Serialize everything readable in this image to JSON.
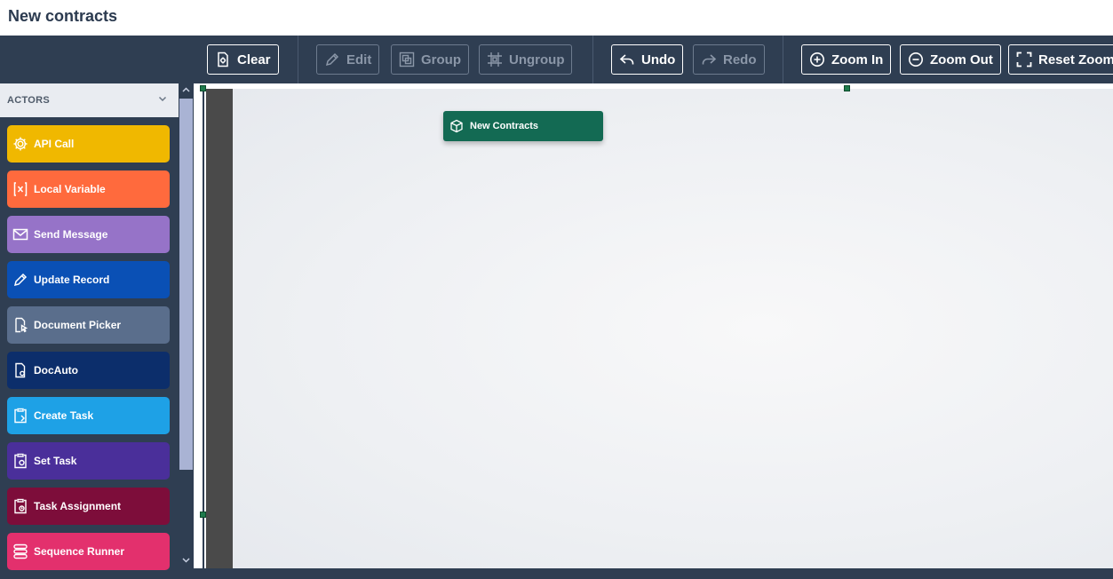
{
  "page": {
    "title": "New contracts"
  },
  "toolbar": {
    "clear": "Clear",
    "edit": "Edit",
    "group": "Group",
    "ungroup": "Ungroup",
    "undo": "Undo",
    "redo": "Redo",
    "zoom_in": "Zoom In",
    "zoom_out": "Zoom Out",
    "reset_zoom": "Reset Zoom"
  },
  "sidebar": {
    "header": "ACTORS",
    "items": [
      {
        "label": "API Call",
        "icon": "gear-icon",
        "color": "#f0b800"
      },
      {
        "label": "Local Variable",
        "icon": "variable-icon",
        "color": "#ff6a3d"
      },
      {
        "label": "Send Message",
        "icon": "envelope-icon",
        "color": "#9673c8"
      },
      {
        "label": "Update Record",
        "icon": "pencil-icon",
        "color": "#0a50b5"
      },
      {
        "label": "Document Picker",
        "icon": "document-picker-icon",
        "color": "#5a6e8c"
      },
      {
        "label": "DocAuto",
        "icon": "doc-gear-icon",
        "color": "#0c2e6b"
      },
      {
        "label": "Create Task",
        "icon": "task-icon",
        "color": "#1ea1e6"
      },
      {
        "label": "Set Task",
        "icon": "task-gear-icon",
        "color": "#4a2f9a"
      },
      {
        "label": "Task Assignment",
        "icon": "task-assign-icon",
        "color": "#7d0d3a"
      },
      {
        "label": "Sequence Runner",
        "icon": "sequence-icon",
        "color": "#e3306d"
      }
    ]
  },
  "canvas": {
    "node_label": "New Contracts",
    "node_icon": "cube-icon",
    "node_color": "#136a53"
  }
}
